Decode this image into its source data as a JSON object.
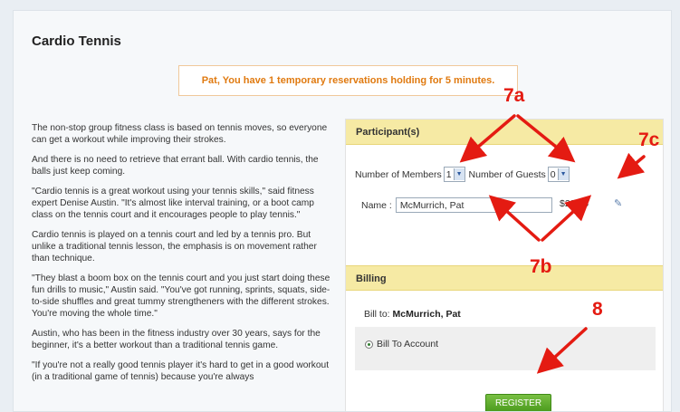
{
  "page": {
    "title": "Cardio Tennis",
    "notice": "Pat, You have 1 temporary reservations holding for 5 minutes."
  },
  "description": {
    "paragraphs": [
      "The non-stop group fitness class is based on tennis moves, so everyone can get a workout while improving their strokes.",
      "And there is no need to retrieve that errant ball. With cardio tennis, the balls just keep coming.",
      "\"Cardio tennis is a great workout using your tennis skills,\" said fitness expert Denise Austin. \"It's almost like interval training, or a boot camp class on the tennis court and it encourages people to play tennis.\"",
      "Cardio tennis is played on a tennis court and led by a tennis pro. But unlike a traditional tennis lesson, the emphasis is on movement rather than technique.",
      "\"They blast a boom box on the tennis court and you just start doing these fun drills to music,\" Austin said. \"You've got running, sprints, squats, side-to-side shuffles and great tummy strengtheners with the different strokes. You're moving the whole time.\"",
      "Austin, who has been in the fitness industry over 30 years, says for the beginner, it's a better workout than a traditional tennis game.",
      "\"If you're not a really good tennis player it's hard to get in a good workout (in a traditional game of tennis) because you're always"
    ]
  },
  "participants": {
    "header": "Participant(s)",
    "members_label": "Number of Members",
    "members_value": "1",
    "guests_label": "Number of Guests",
    "guests_value": "0",
    "name_label": "Name :",
    "name_value": "McMurrich, Pat",
    "price": "$28.25",
    "edit_icon": "pencil-icon"
  },
  "billing": {
    "header": "Billing",
    "bill_to_label": "Bill to:",
    "bill_to_name": "McMurrich, Pat",
    "option_label": "Bill To Account",
    "register_label": "REGISTER"
  },
  "annotations": {
    "a7a": "7a",
    "a7b": "7b",
    "a7c": "7c",
    "a8": "8"
  },
  "colors": {
    "annotation": "#e41b12",
    "panel_header": "#f6eaa4",
    "notice_text": "#e07a10",
    "register_button": "#5fae2a"
  }
}
